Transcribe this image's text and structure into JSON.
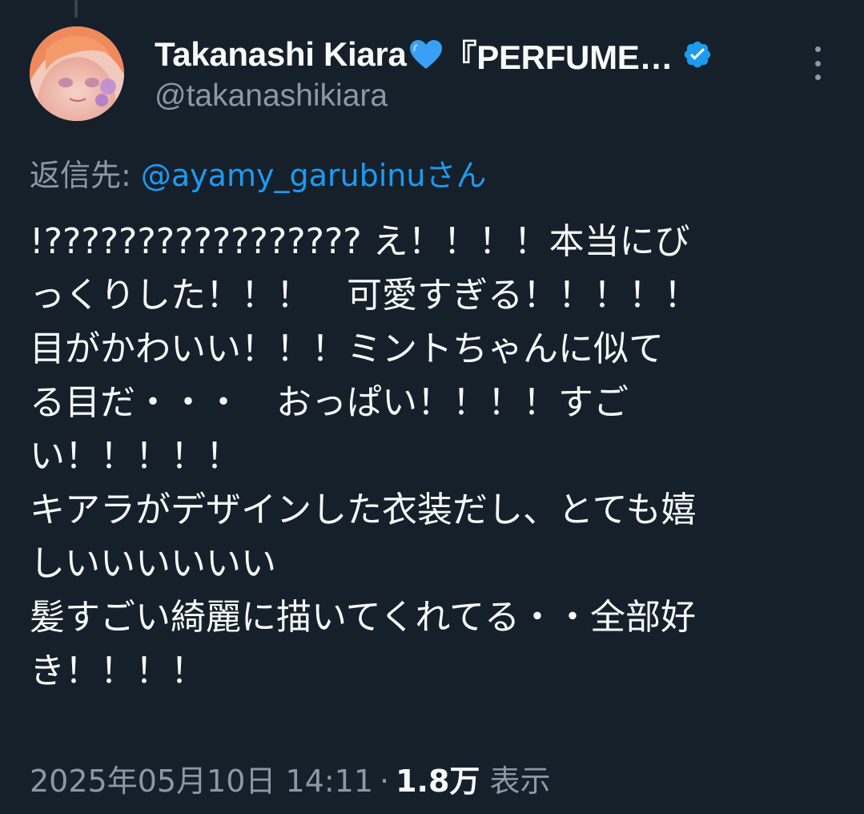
{
  "author": {
    "display_name": "Takanashi Kiara",
    "name_suffix": "『PERFUME…",
    "handle": "@takanashikiara"
  },
  "reply": {
    "label": "返信先: ",
    "to": "@ayamy_garubinuさん"
  },
  "tweet_lines": [
    "!????????????????? え！！！！本当にび",
    "っくりした！！！　可愛すぎる！！！！！",
    "目がかわいい！！！ミントちゃんに似て",
    "る目だ・・・　おっぱい！！！！すご",
    "い！！！！！",
    "キアラがデザインした衣装だし、とても嬉",
    "しいいいいいい",
    "髪すごい綺麗に描いてくれてる・・全部好",
    "き！！！！"
  ],
  "meta": {
    "timestamp": "2025年05月10日 14:11",
    "separator": "·",
    "views": "1.8万",
    "views_label": "表示"
  },
  "icons": {
    "heart": "blue-heart-icon",
    "verified": "verified-badge-icon",
    "more": "more-options-icon"
  },
  "colors": {
    "background": "#15202b",
    "text": "#f7f9f9",
    "secondary": "#8b98a5",
    "accent": "#1d9bf0"
  }
}
